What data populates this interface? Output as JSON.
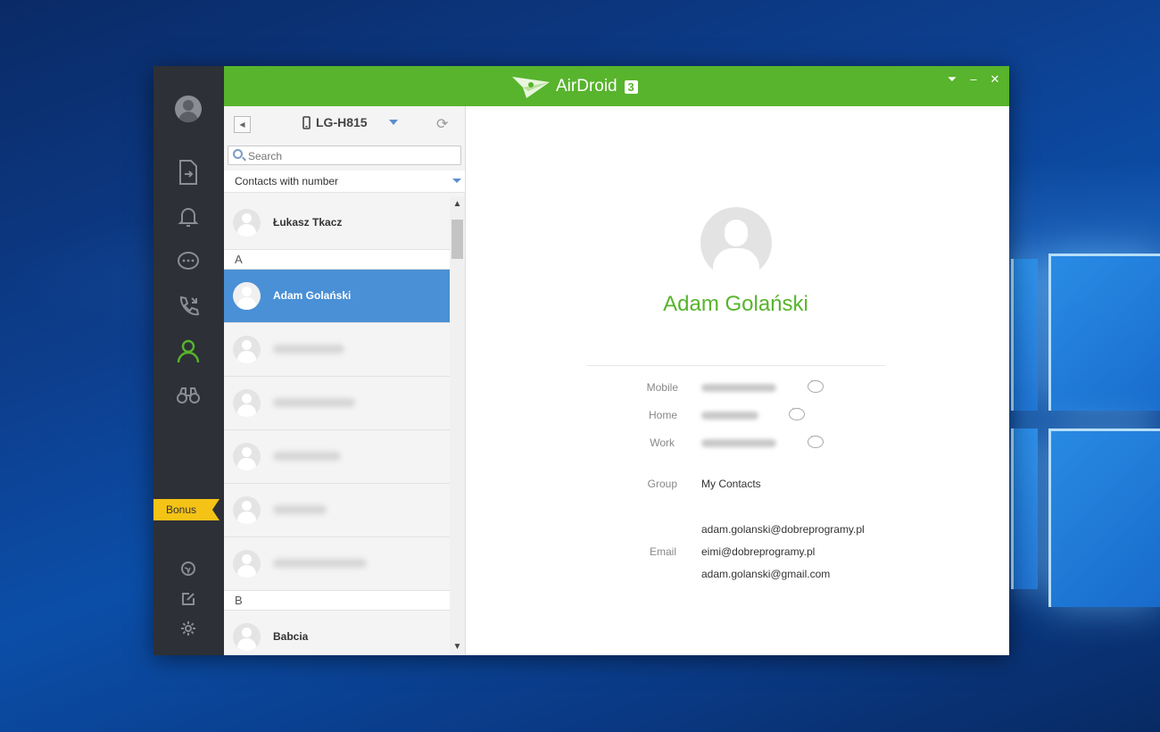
{
  "app": {
    "name": "AirDroid",
    "version_badge": "3",
    "accent": "#57b42c",
    "selection": "#4a90d6"
  },
  "rail": {
    "items": [
      {
        "name": "files-icon"
      },
      {
        "name": "notifications-icon"
      },
      {
        "name": "messages-icon"
      },
      {
        "name": "calls-icon"
      },
      {
        "name": "contacts-icon"
      },
      {
        "name": "find-phone-icon"
      }
    ],
    "bonus_label": "Bonus",
    "bottom_items": [
      {
        "name": "web-icon"
      },
      {
        "name": "feedback-icon"
      },
      {
        "name": "settings-icon"
      }
    ]
  },
  "device": {
    "name": "LG-H815"
  },
  "search": {
    "placeholder": "Search"
  },
  "filter": {
    "selected": "Contacts with number"
  },
  "contacts": {
    "top_item": "Łukasz Tkacz",
    "section_a": "A",
    "selected": "Adam Golański",
    "section_b": "B",
    "last_item": "Babcia"
  },
  "detail": {
    "name": "Adam Golański",
    "labels": {
      "mobile": "Mobile",
      "home": "Home",
      "work": "Work",
      "group": "Group",
      "email": "Email"
    },
    "group": "My Contacts",
    "emails": [
      "adam.golanski@dobreprogramy.pl",
      "eimi@dobreprogramy.pl",
      "adam.golanski@gmail.com"
    ]
  }
}
